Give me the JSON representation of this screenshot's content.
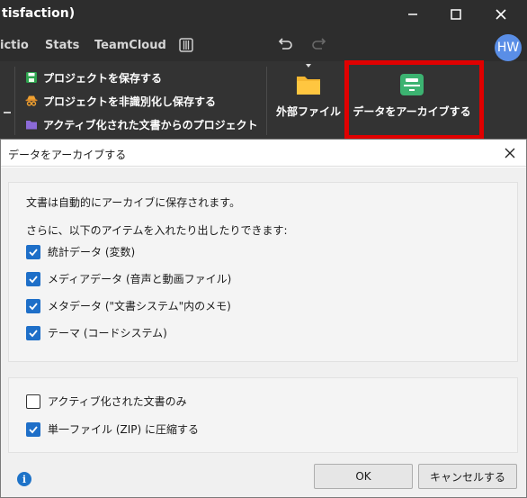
{
  "window": {
    "title": "tisfaction)"
  },
  "menubar": {
    "items": [
      "ictio",
      "Stats",
      "TeamCloud"
    ],
    "avatar_initials": "HW"
  },
  "ribbon": {
    "items": [
      "プロジェクトを保存する",
      "プロジェクトを非識別化し保存する",
      "アクティブ化された文書からのプロジェクト"
    ],
    "external_files_label": "外部ファイル",
    "archive_label": "データをアーカイブする"
  },
  "dialog": {
    "title": "データをアーカイブする",
    "auto_archive_text": "文書は自動的にアーカイブに保存されます。",
    "additional_text": "さらに、以下のアイテムを入れたり出したりできます:",
    "items": [
      {
        "label": "統計データ (変数)",
        "checked": true
      },
      {
        "label": "メディアデータ (音声と動画ファイル)",
        "checked": true
      },
      {
        "label": "メタデータ (\"文書システム\"内のメモ)",
        "checked": true
      },
      {
        "label": "テーマ (コードシステム)",
        "checked": true
      }
    ],
    "options": [
      {
        "label": "アクティブ化された文書のみ",
        "checked": false
      },
      {
        "label": "単一ファイル (ZIP) に圧縮する",
        "checked": true
      }
    ],
    "ok_label": "OK",
    "cancel_label": "キャンセルする"
  },
  "colors": {
    "accent": "#1e6fc8",
    "highlight": "#e00000",
    "archive_icon": "#3cb371",
    "folder_icon": "#f5b731"
  }
}
